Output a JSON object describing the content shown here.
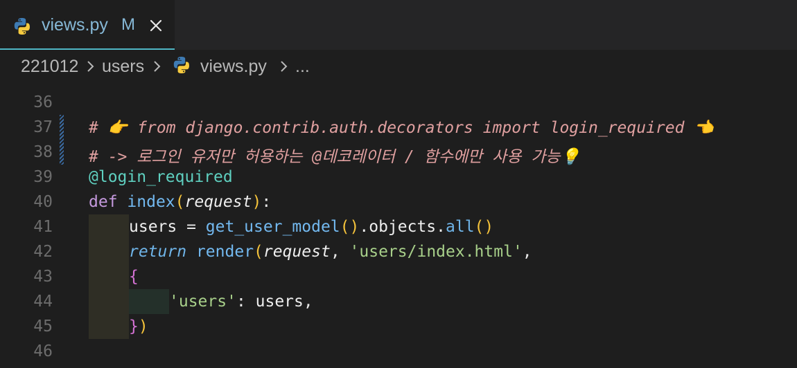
{
  "tab": {
    "title": "views.py",
    "modified_indicator": "M",
    "close_icon": "close-icon",
    "file_icon": "python-icon"
  },
  "breadcrumb": {
    "items": [
      "221012",
      "users",
      "views.py",
      "..."
    ]
  },
  "editor": {
    "partial_top_line": "35",
    "lines": [
      {
        "number": "36",
        "text": ""
      },
      {
        "number": "37",
        "text": "# 👉 from django.contrib.auth.decorators import login_required 👈"
      },
      {
        "number": "38",
        "text": "# -> 로그인 유저만 허용하는 @데코레이터 / 함수에만 사용 가능💡"
      },
      {
        "number": "39",
        "text": "@login_required"
      },
      {
        "number": "40",
        "text": "def index(request):"
      },
      {
        "number": "41",
        "text": "    users = get_user_model().objects.all()"
      },
      {
        "number": "42",
        "text": "    return render(request, 'users/index.html',"
      },
      {
        "number": "43",
        "text": "    {"
      },
      {
        "number": "44",
        "text": "        'users': users,"
      },
      {
        "number": "45",
        "text": "    })"
      },
      {
        "number": "46",
        "text": ""
      }
    ],
    "tokens": {
      "l37_comment": "# 👉 from django.contrib.auth.decorators import login_required 👈",
      "l38_comment": "# -> 로그인 유저만 허용하는 @데코레이터 / 함수에만 사용 가능💡",
      "l39_decorator": "@login_required",
      "l40_def": "def",
      "l40_fn": "index",
      "l40_param": "request",
      "l41_var": "users",
      "l41_eq": " = ",
      "l41_fn": "get_user_model",
      "l41_attr1": ".objects.",
      "l41_method": "all",
      "l42_return": "return",
      "l42_fn": "render",
      "l42_param": "request",
      "l42_str": "'users/index.html'",
      "l44_str": "'users'",
      "l44_var": "users"
    }
  },
  "colors": {
    "accent": "#4fb7c5",
    "background": "#1e1e1e",
    "comment": "#e0a0a0",
    "string": "#a8d08a",
    "keyword": "#c59ade",
    "function": "#73b9f0"
  }
}
